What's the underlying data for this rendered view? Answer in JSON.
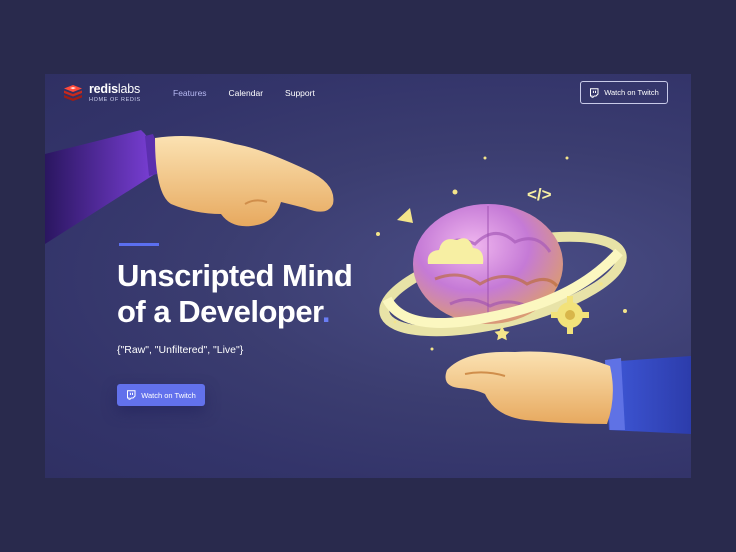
{
  "brand": {
    "name_bold": "redis",
    "name_light": "labs",
    "tagline": "HOME OF REDIS",
    "logo_color": "#d82c20"
  },
  "nav": {
    "items": [
      {
        "label": "Features"
      },
      {
        "label": "Calendar"
      },
      {
        "label": "Support"
      }
    ]
  },
  "header": {
    "cta_label": "Watch on Twitch",
    "cta_icon": "twitch-icon"
  },
  "hero": {
    "title_line1": "Unscripted Mind",
    "title_line2": "of a Developer",
    "title_dot": ".",
    "subtitle": "{\"Raw\", \"Unfiltered\", \"Live\"}",
    "cta_label": "Watch on Twitch",
    "cta_icon": "twitch-icon"
  },
  "illustration": {
    "code_symbol": "</>"
  },
  "colors": {
    "page_bg": "#292a4d",
    "hero_bg": "#3b3d70",
    "accent": "#6271ec",
    "ring": "#f7f3b0"
  }
}
